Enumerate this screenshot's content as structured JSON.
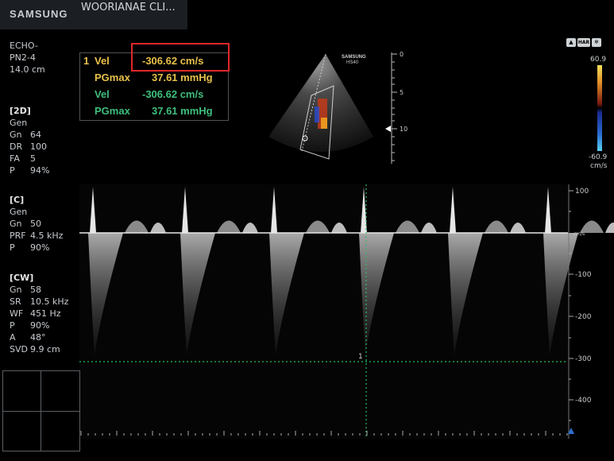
{
  "header": {
    "brand": "SAMSUNG",
    "clinic": "WOORIANAE CLI..."
  },
  "probe": {
    "preset": "ECHO-",
    "probe_name": "PN2-4",
    "depth": "14.0 cm"
  },
  "mode_2d": {
    "title": "[2D]",
    "lines": [
      {
        "k": "Gen",
        "v": ""
      },
      {
        "k": "Gn",
        "v": "64"
      },
      {
        "k": "DR",
        "v": "100"
      },
      {
        "k": "FA",
        "v": "5"
      },
      {
        "k": "P",
        "v": "94%"
      }
    ]
  },
  "mode_c": {
    "title": "[C]",
    "lines": [
      {
        "k": "Gen",
        "v": ""
      },
      {
        "k": "Gn",
        "v": "50"
      },
      {
        "k": "PRF",
        "v": "4.5 kHz"
      },
      {
        "k": "P",
        "v": "90%"
      }
    ]
  },
  "mode_cw": {
    "title": "[CW]",
    "lines": [
      {
        "k": "Gn",
        "v": "58"
      },
      {
        "k": "SR",
        "v": "10.5 kHz"
      },
      {
        "k": "WF",
        "v": "451 Hz"
      },
      {
        "k": "P",
        "v": "90%"
      },
      {
        "k": "A",
        "v": "48°"
      },
      {
        "k": "SVD",
        "v": "9.9 cm"
      }
    ]
  },
  "measurements": {
    "row1_index": "1",
    "row1_label": "Vel",
    "row1_value": "-306.62 cm/s",
    "row2_label": "PGmax",
    "row2_value": "37.61 mmHg",
    "row3_label": "Vel",
    "row3_value": "-306.62 cm/s",
    "row4_label": "PGmax",
    "row4_value": "37.61 mmHg"
  },
  "sector_image": {
    "device_line1": "SAMSUNG",
    "device_line2": "HS40",
    "depth_marks": [
      "0",
      "5",
      "10"
    ]
  },
  "color_scale": {
    "max": "60.9",
    "min": "-60.9",
    "unit": "cm/s"
  },
  "spectral_scale": {
    "unit": "cm/s",
    "ticks": [
      "100",
      "-100",
      "-200",
      "-300",
      "-400"
    ],
    "cursor_label": "1"
  },
  "status_icons": [
    "HAR"
  ],
  "colors": {
    "yellow": "#e8c14a",
    "green": "#3fbf7d",
    "highlight": "#e0272a",
    "cursor": "#2fbf5a"
  }
}
